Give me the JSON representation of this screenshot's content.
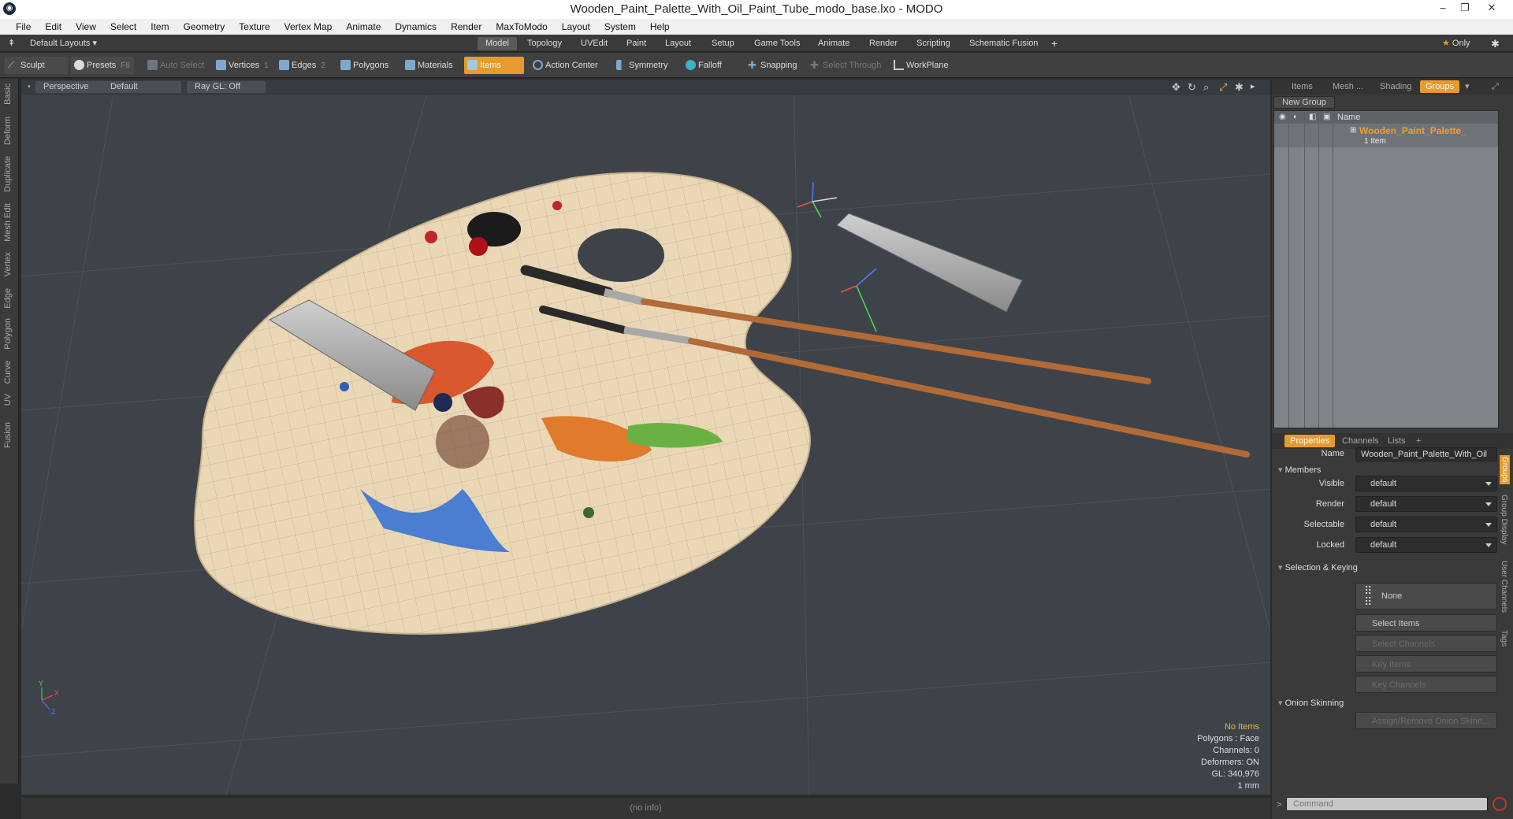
{
  "window": {
    "title": "Wooden_Paint_Palette_With_Oil_Paint_Tube_modo_base.lxo - MODO",
    "app_icon": "modo-logo-icon",
    "controls": [
      "–",
      "❐",
      "✕"
    ]
  },
  "menubar": [
    "File",
    "Edit",
    "View",
    "Select",
    "Item",
    "Geometry",
    "Texture",
    "Vertex Map",
    "Animate",
    "Dynamics",
    "Render",
    "MaxToModo",
    "Layout",
    "System",
    "Help"
  ],
  "layoutbar": {
    "layouts_label": "Default Layouts",
    "tabs": [
      "Model",
      "Topology",
      "UVEdit",
      "Paint",
      "Layout",
      "Setup",
      "Game Tools",
      "Animate",
      "Render",
      "Scripting",
      "Schematic Fusion"
    ],
    "active_tab": "Model",
    "only_label": "Only"
  },
  "toolbar": {
    "sculpt": "Sculpt",
    "presets": "Presets",
    "presets_key": "F6",
    "auto_select": "Auto Select",
    "vertices": "Vertices",
    "vertices_key": "1",
    "edges": "Edges",
    "edges_key": "2",
    "polygons": "Polygons",
    "materials": "Materials",
    "items": "Items",
    "action_center": "Action Center",
    "symmetry": "Symmetry",
    "falloff": "Falloff",
    "snapping": "Snapping",
    "select_through": "Select Through",
    "workplane": "WorkPlane"
  },
  "left_tabs": [
    "Basic",
    "Deform",
    "Duplicate",
    "Mesh Edit",
    "Vertex",
    "Edge",
    "Polygon",
    "Curve",
    "UV",
    "Fusion"
  ],
  "viewport": {
    "view_mode": "Perspective",
    "shading": "Default",
    "raygl": "Ray GL: Off",
    "hud": {
      "no_items": "No Items",
      "polygons": "Polygons : Face",
      "channels": "Channels: 0",
      "deformers": "Deformers: ON",
      "gl": "GL: 340,976",
      "unit": "1 mm"
    },
    "axis_labels": [
      "Y",
      "X",
      "Z"
    ]
  },
  "statusbar": {
    "info": "(no info)"
  },
  "groups_panel": {
    "tabs": [
      "Items",
      "Mesh ...",
      "Shading",
      "Groups"
    ],
    "active_tab": "Groups",
    "new_group": "New Group",
    "column_name": "Name",
    "group_name": "Wooden_Paint_Palette_",
    "group_count": "1 Item"
  },
  "properties_panel": {
    "tabs": [
      "Properties",
      "Channels",
      "Lists"
    ],
    "active_tab": "Properties",
    "name_label": "Name",
    "name_value": "Wooden_Paint_Palette_With_Oil",
    "members_section": "Members",
    "fields": [
      {
        "label": "Visible",
        "value": "default"
      },
      {
        "label": "Render",
        "value": "default"
      },
      {
        "label": "Selectable",
        "value": "default"
      },
      {
        "label": "Locked",
        "value": "default"
      }
    ],
    "selection_section": "Selection & Keying",
    "none_label": "None",
    "select_items": "Select Items",
    "select_channels": "Select Channels",
    "key_items": "Key Items",
    "key_channels": "Key Channels",
    "onion_section": "Onion Skinning",
    "assign_onion": "Assign/Remove Onion Skinn...",
    "side_tabs": [
      "Groups",
      "Group Display",
      "User Channels",
      "Tags"
    ]
  },
  "command": {
    "placeholder": "Command"
  }
}
